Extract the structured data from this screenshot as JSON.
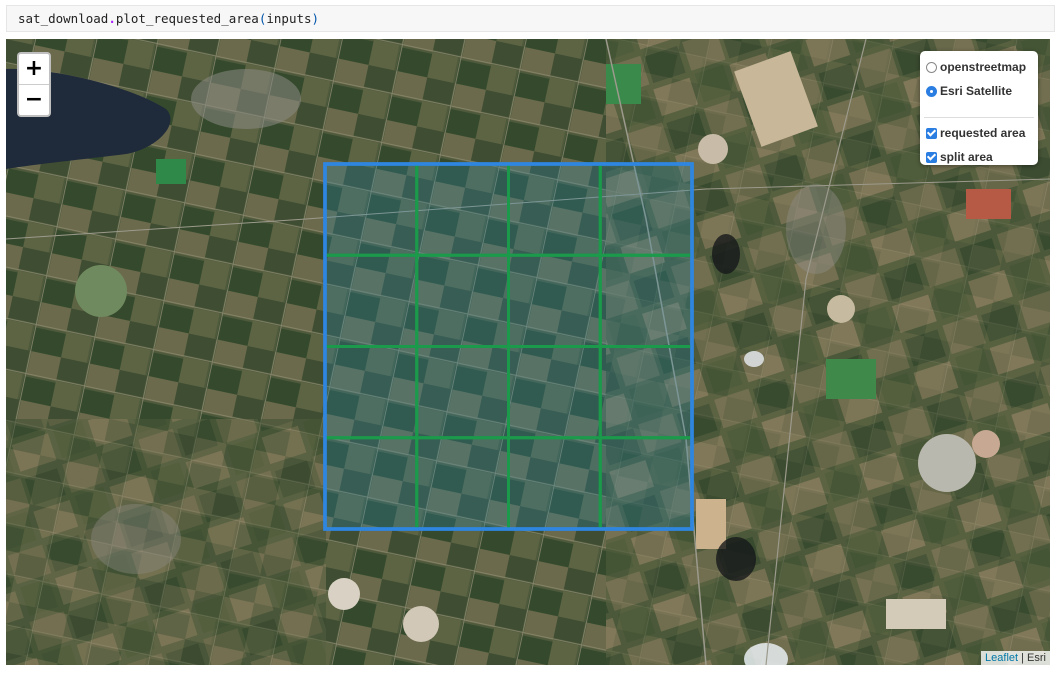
{
  "code_cell": {
    "object": "sat_download",
    "dot": ".",
    "method": "plot_requested_area",
    "open_paren": "(",
    "argument": "inputs",
    "close_paren": ")"
  },
  "map": {
    "zoom_in": "+",
    "zoom_out": "−",
    "layers_control": {
      "base_layers": [
        {
          "label": "openstreetmap",
          "selected": false
        },
        {
          "label": "Esri Satellite",
          "selected": true
        }
      ],
      "overlays": [
        {
          "label": "requested area",
          "checked": true
        },
        {
          "label": "split area",
          "checked": true
        }
      ]
    },
    "attribution": {
      "link": "Leaflet",
      "separator": " | ",
      "provider": "Esri"
    },
    "overlay_colors": {
      "requested_area": "#2f86e0",
      "split_area": "#1a9a4a"
    },
    "split_grid": {
      "rows": 4,
      "cols": 4
    }
  }
}
